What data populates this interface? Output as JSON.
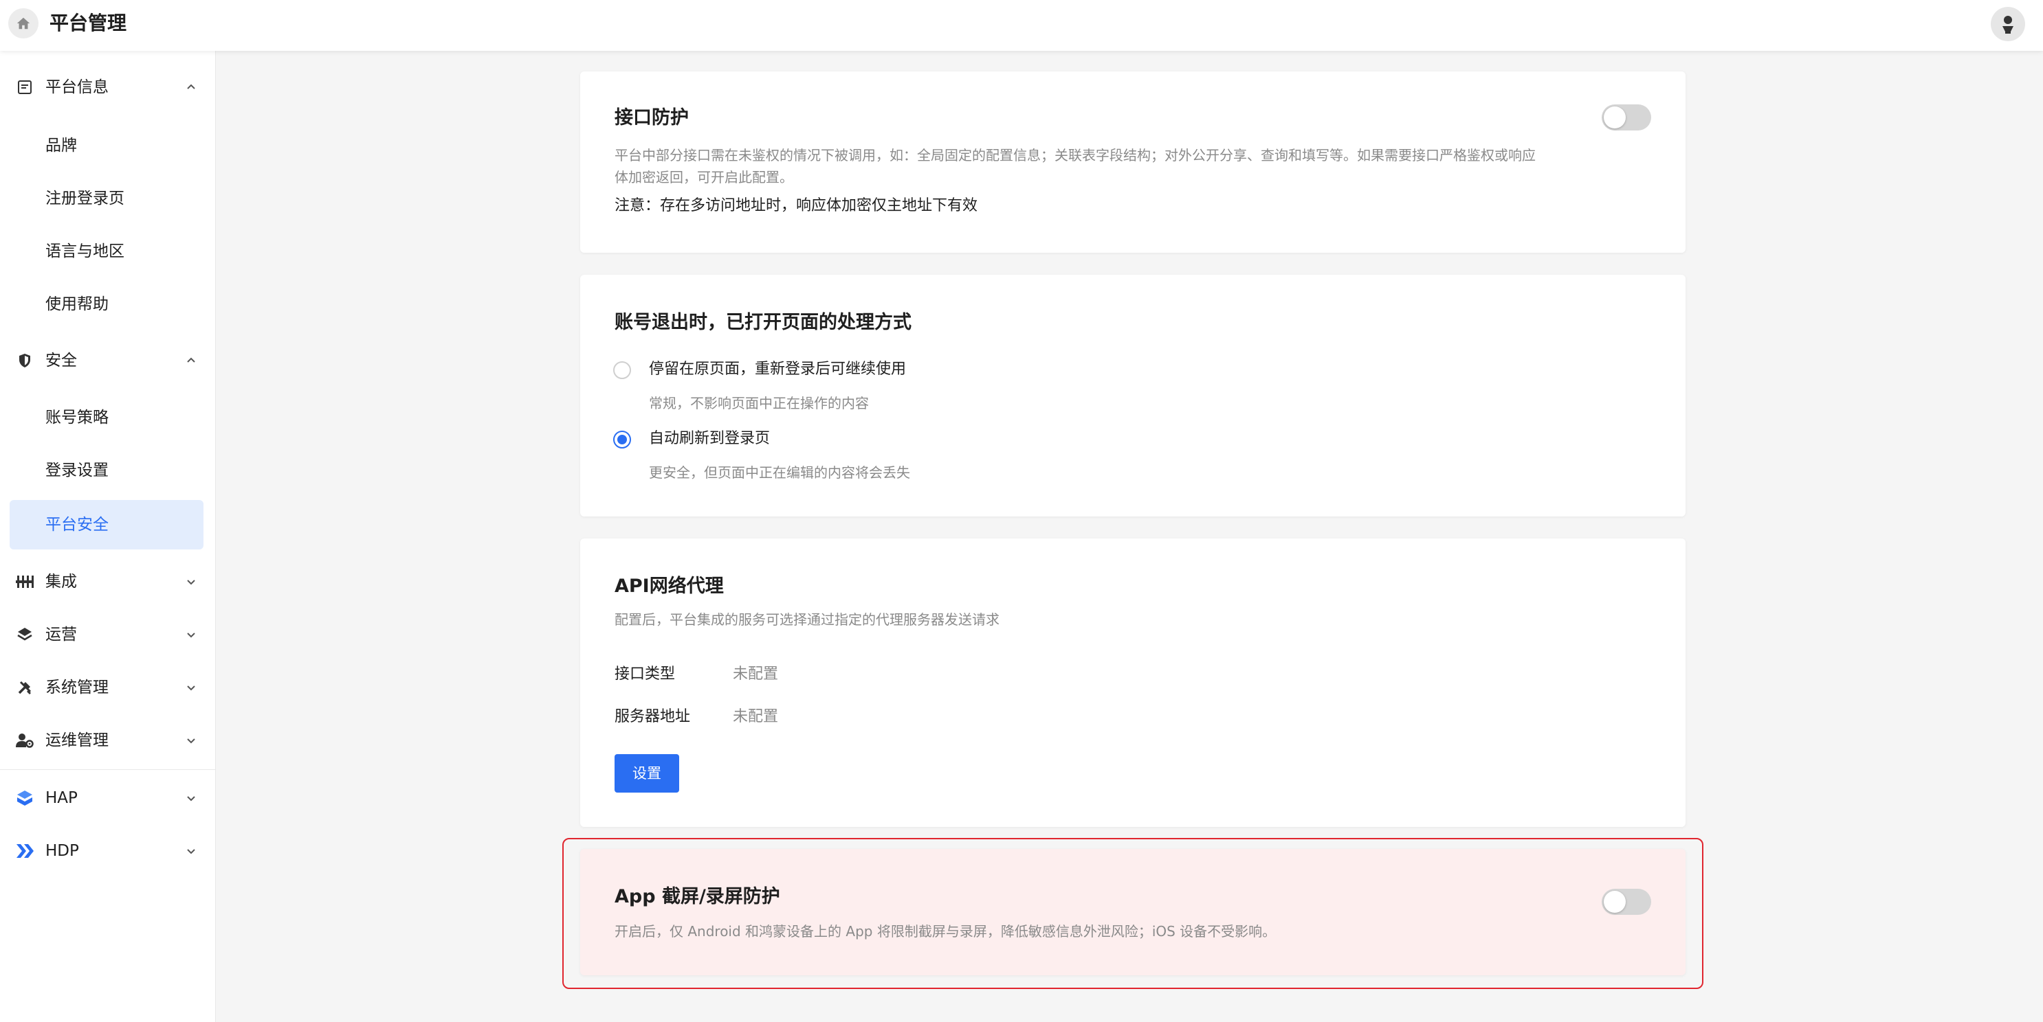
{
  "header": {
    "title": "平台管理"
  },
  "sidebar": {
    "platform_info": {
      "label": "平台信息",
      "items": [
        "品牌",
        "注册登录页",
        "语言与地区",
        "使用帮助"
      ]
    },
    "security": {
      "label": "安全",
      "items": [
        "账号策略",
        "登录设置",
        "平台安全"
      ],
      "active": "平台安全"
    },
    "integration": {
      "label": "集成"
    },
    "operations": {
      "label": "运营"
    },
    "system_admin": {
      "label": "系统管理"
    },
    "devops_admin": {
      "label": "运维管理"
    },
    "hap": {
      "label": "HAP"
    },
    "hdp": {
      "label": "HDP"
    }
  },
  "api_protection": {
    "title": "接口防护",
    "desc_line1": "平台中部分接口需在未鉴权的情况下被调用，如：全局固定的配置信息；关联表字段结构；对外公开分享、查询和填写等。如果需要接口严格鉴权或响应",
    "desc_line2": "体加密返回，可开启此配置。",
    "note": "注意：存在多访问地址时，响应体加密仅主地址下有效",
    "enabled": false
  },
  "logout_handling": {
    "title": "账号退出时，已打开页面的处理方式",
    "options": [
      {
        "label": "停留在原页面，重新登录后可继续使用",
        "help": "常规，不影响页面中正在操作的内容",
        "checked": false
      },
      {
        "label": "自动刷新到登录页",
        "help": "更安全，但页面中正在编辑的内容将会丢失",
        "checked": true
      }
    ]
  },
  "api_proxy": {
    "title": "API网络代理",
    "desc": "配置后，平台集成的服务可选择通过指定的代理服务器发送请求",
    "fields": [
      {
        "key": "接口类型",
        "value": "未配置"
      },
      {
        "key": "服务器地址",
        "value": "未配置"
      }
    ],
    "button": "设置"
  },
  "screen_protection": {
    "title": "App 截屏/录屏防护",
    "desc": "开启后，仅 Android 和鸿蒙设备上的 App 将限制截屏与录屏，降低敏感信息外泄风险；iOS 设备不受影响。",
    "enabled": false
  },
  "colors": {
    "primary": "#2a6ef2",
    "highlight_border": "#e0262f",
    "highlight_bg": "#fdeeee"
  }
}
